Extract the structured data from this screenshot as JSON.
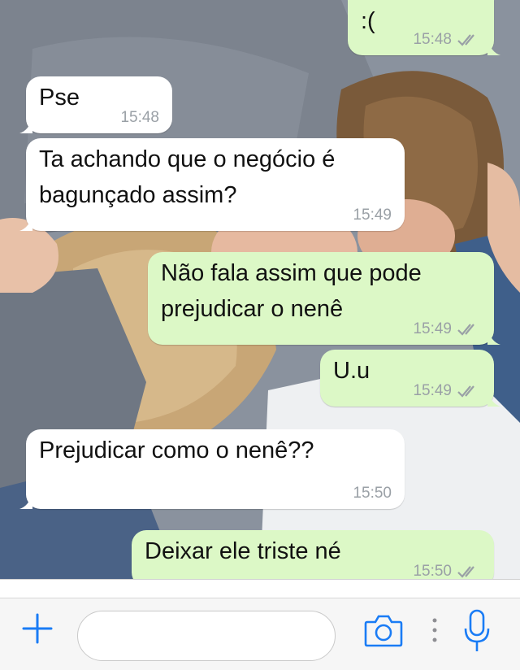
{
  "messages": [
    {
      "direction": "out",
      "text": ":(",
      "time": "15:48",
      "status": "read"
    },
    {
      "direction": "in",
      "text": "Pse",
      "time": "15:48"
    },
    {
      "direction": "in",
      "text": "Ta achando que o negócio é\nbagunçado assim?",
      "time": "15:49"
    },
    {
      "direction": "out",
      "text": "Não fala assim que pode\nprejudicar o nenê",
      "time": "15:49",
      "status": "read"
    },
    {
      "direction": "out",
      "text": "U.u",
      "time": "15:49",
      "status": "read"
    },
    {
      "direction": "in",
      "text": "Prejudicar como o nenê??",
      "time": "15:50"
    },
    {
      "direction": "out",
      "text": "Deixar ele triste né",
      "time": "15:50",
      "status": "read"
    }
  ],
  "composer": {
    "input_value": "",
    "icons": [
      "plus-icon",
      "camera-icon",
      "more-dots-icon",
      "microphone-icon"
    ]
  },
  "colors": {
    "accent": "#1a7cf5",
    "outgoing_bubble": "#dcf8c6",
    "incoming_bubble": "#ffffff",
    "meta_text": "#9aa0a6"
  }
}
